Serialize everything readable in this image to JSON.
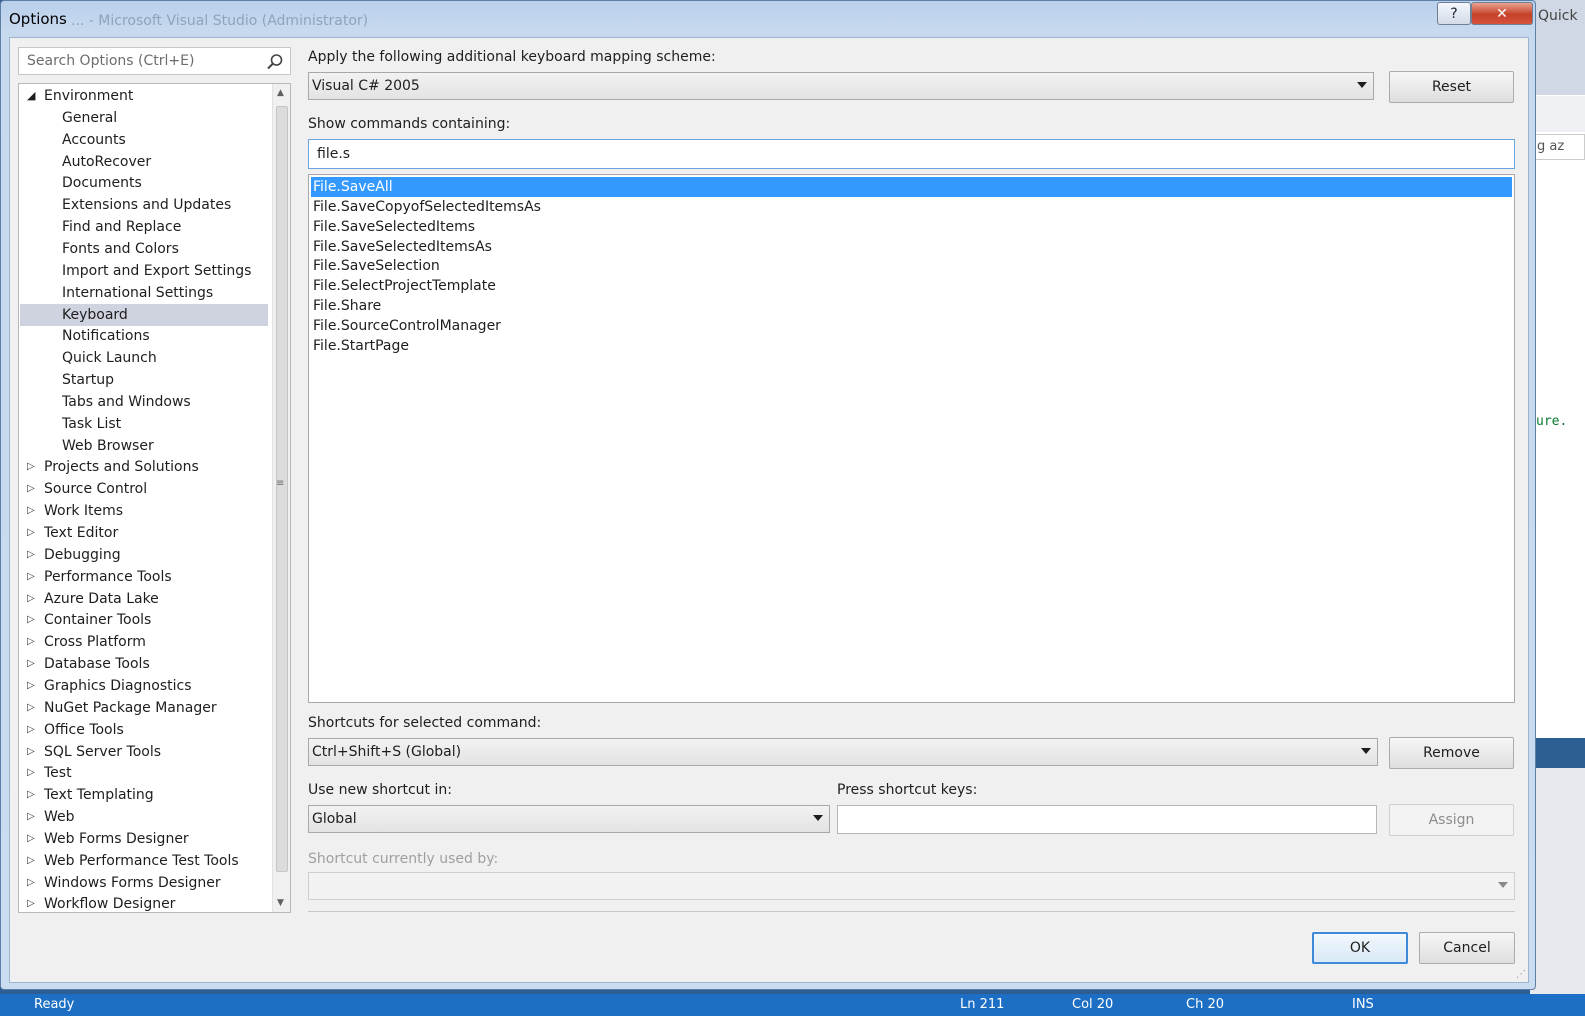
{
  "background": {
    "quick_fragment": "Quick",
    "search_fragment": "g az",
    "code_fragment": "ure.",
    "status": {
      "text": "Ready",
      "ln": "Ln 211",
      "col": "Col 20",
      "ch": "Ch 20",
      "ins": "INS"
    },
    "ghost_title": "... - Microsoft Visual Studio (Administrator)"
  },
  "window": {
    "title": "Options",
    "help_glyph": "?",
    "close_glyph": "✕"
  },
  "search": {
    "placeholder": "Search Options (Ctrl+E)"
  },
  "tree": {
    "environment": {
      "label": "Environment",
      "children": [
        "General",
        "Accounts",
        "AutoRecover",
        "Documents",
        "Extensions and Updates",
        "Find and Replace",
        "Fonts and Colors",
        "Import and Export Settings",
        "International Settings",
        "Keyboard",
        "Notifications",
        "Quick Launch",
        "Startup",
        "Tabs and Windows",
        "Task List",
        "Web Browser"
      ],
      "selected": "Keyboard"
    },
    "groups": [
      "Projects and Solutions",
      "Source Control",
      "Work Items",
      "Text Editor",
      "Debugging",
      "Performance Tools",
      "Azure Data Lake",
      "Container Tools",
      "Cross Platform",
      "Database Tools",
      "Graphics Diagnostics",
      "NuGet Package Manager",
      "Office Tools",
      "SQL Server Tools",
      "Test",
      "Text Templating",
      "Web",
      "Web Forms Designer",
      "Web Performance Test Tools",
      "Windows Forms Designer",
      "Workflow Designer"
    ]
  },
  "keyboard": {
    "mapping_label": "Apply the following additional keyboard mapping scheme:",
    "mapping_value": "Visual C# 2005",
    "reset_label": "Reset",
    "show_commands_label": "Show commands containing:",
    "filter_value": "file.s",
    "commands": [
      "File.SaveAll",
      "File.SaveCopyofSelectedItemsAs",
      "File.SaveSelectedItems",
      "File.SaveSelectedItemsAs",
      "File.SaveSelection",
      "File.SelectProjectTemplate",
      "File.Share",
      "File.SourceControlManager",
      "File.StartPage"
    ],
    "selected_command": "File.SaveAll",
    "shortcuts_label": "Shortcuts for selected command:",
    "shortcut_value": "Ctrl+Shift+S (Global)",
    "remove_label": "Remove",
    "use_new_label": "Use new shortcut in:",
    "use_new_value": "Global",
    "press_keys_label": "Press shortcut keys:",
    "press_keys_value": "",
    "assign_label": "Assign",
    "used_by_label": "Shortcut currently used by:",
    "used_by_value": ""
  },
  "buttons": {
    "ok": "OK",
    "cancel": "Cancel"
  },
  "colors": {
    "selection": "#3399ff",
    "tree_selected": "#cfd3e0",
    "status_bar": "#1c6fc4"
  }
}
